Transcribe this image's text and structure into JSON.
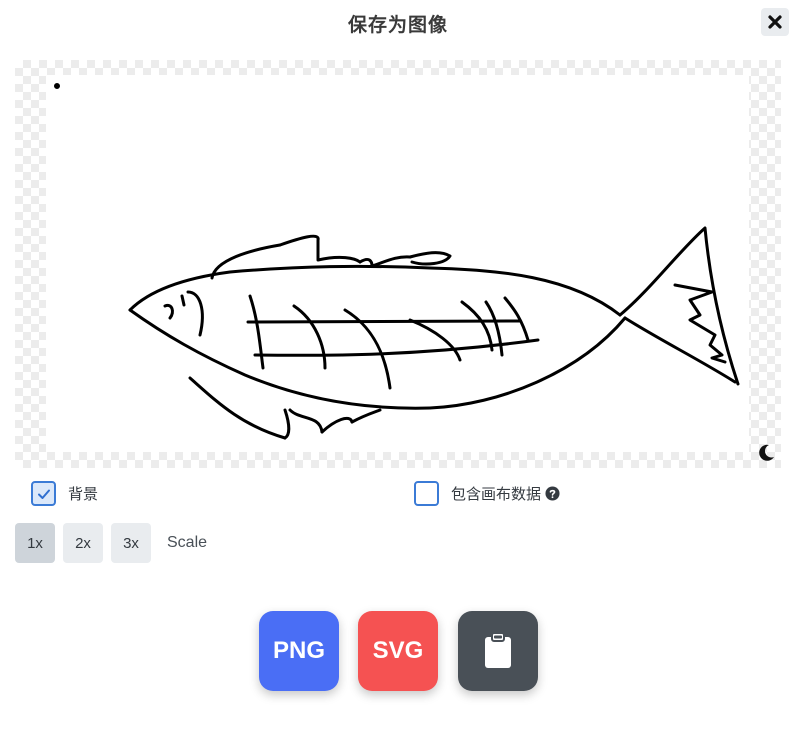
{
  "dialog": {
    "title": "保存为图像",
    "close_icon": "close-icon"
  },
  "preview": {
    "theme_toggle_icon": "moon-icon",
    "drawing": "fish-sketch"
  },
  "options": {
    "background": {
      "label": "背景",
      "checked": true
    },
    "embed_scene": {
      "label": "包含画布数据",
      "checked": false,
      "help_icon": "question-circle-icon"
    }
  },
  "scale": {
    "label": "Scale",
    "buttons": [
      {
        "label": "1x",
        "active": true
      },
      {
        "label": "2x",
        "active": false
      },
      {
        "label": "3x",
        "active": false
      }
    ]
  },
  "export": {
    "png_label": "PNG",
    "svg_label": "SVG",
    "clipboard_icon": "clipboard-icon",
    "png_color": "#4a6ef5",
    "svg_color": "#f55252",
    "clipboard_color": "#495057"
  }
}
